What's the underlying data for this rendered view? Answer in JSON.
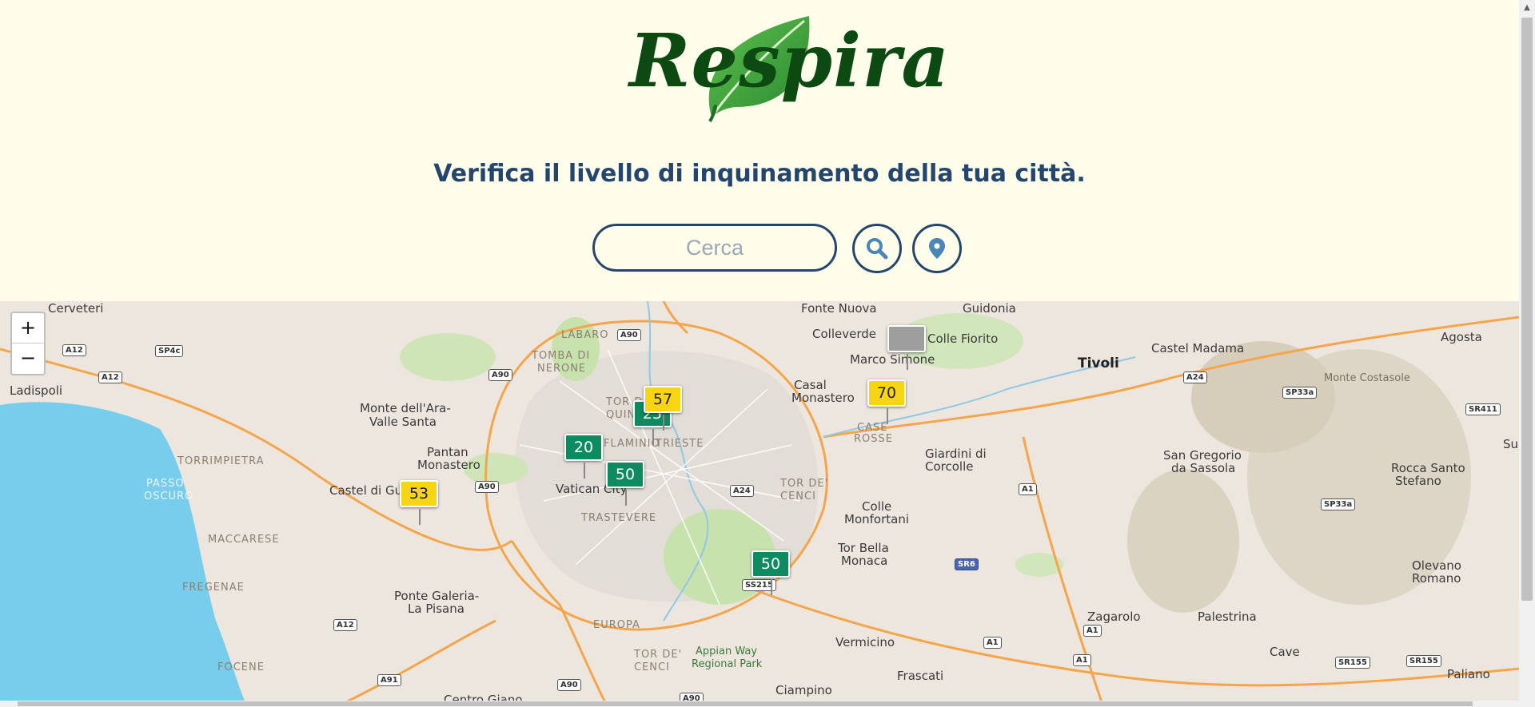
{
  "app": {
    "logo_text": "Respira"
  },
  "header": {
    "tagline": "Verifica il livello di inquinamento della tua città."
  },
  "search": {
    "placeholder": "Cerca",
    "value": ""
  },
  "buttons": {
    "search_icon": "search-icon",
    "location_icon": "location-pin-icon"
  },
  "map": {
    "zoom_in": "+",
    "zoom_out": "−",
    "labels": [
      {
        "text": "Cerveteri",
        "cls": ""
      },
      {
        "text": "Ladispoli",
        "cls": ""
      },
      {
        "text": "Monte dell'Ara-",
        "cls": ""
      },
      {
        "text": "Valle Santa",
        "cls": ""
      },
      {
        "text": "TORRIMPIETRA",
        "cls": "small"
      },
      {
        "text": "PASSO",
        "cls": "sea"
      },
      {
        "text": "OSCURO",
        "cls": "sea"
      },
      {
        "text": "Pantan",
        "cls": ""
      },
      {
        "text": "Monastero",
        "cls": ""
      },
      {
        "text": "Castel di Guido",
        "cls": ""
      },
      {
        "text": "MACCARESE",
        "cls": "small"
      },
      {
        "text": "FREGENAE",
        "cls": "small"
      },
      {
        "text": "Ponte Galeria-",
        "cls": ""
      },
      {
        "text": "La Pisana",
        "cls": ""
      },
      {
        "text": "FOCENE",
        "cls": "small"
      },
      {
        "text": "Centro Giano",
        "cls": ""
      },
      {
        "text": "LABARO",
        "cls": "small"
      },
      {
        "text": "TOMBA DI",
        "cls": "small"
      },
      {
        "text": "NERONE",
        "cls": "small"
      },
      {
        "text": "TOR DI",
        "cls": "small"
      },
      {
        "text": "QUINTO",
        "cls": "small"
      },
      {
        "text": "FLAMINIO",
        "cls": "small"
      },
      {
        "text": "TRIESTE",
        "cls": "small"
      },
      {
        "text": "Vatican City",
        "cls": ""
      },
      {
        "text": "TRASTEVERE",
        "cls": "small"
      },
      {
        "text": "EUROPA",
        "cls": "small"
      },
      {
        "text": "TOR DE'",
        "cls": "small"
      },
      {
        "text": "CENCI",
        "cls": "small"
      },
      {
        "text": "Appian Way",
        "cls": "park"
      },
      {
        "text": "Regional Park",
        "cls": "park"
      },
      {
        "text": "Ciampino",
        "cls": ""
      },
      {
        "text": "Fonte Nuova",
        "cls": ""
      },
      {
        "text": "Colleverde",
        "cls": ""
      },
      {
        "text": "Guidonia",
        "cls": ""
      },
      {
        "text": "Colle Fiorito",
        "cls": ""
      },
      {
        "text": "Marco Simone",
        "cls": ""
      },
      {
        "text": "Casal",
        "cls": ""
      },
      {
        "text": "Monastero",
        "cls": ""
      },
      {
        "text": "CASE",
        "cls": "small"
      },
      {
        "text": "ROSSE",
        "cls": "small"
      },
      {
        "text": "TOR DE'",
        "cls": "small"
      },
      {
        "text": "CENCI",
        "cls": "small"
      },
      {
        "text": "Colle",
        "cls": ""
      },
      {
        "text": "Monfortani",
        "cls": ""
      },
      {
        "text": "Tor Bella",
        "cls": ""
      },
      {
        "text": "Monaca",
        "cls": ""
      },
      {
        "text": "Vermicino",
        "cls": ""
      },
      {
        "text": "Frascati",
        "cls": ""
      },
      {
        "text": "Giardini di",
        "cls": ""
      },
      {
        "text": "Corcolle",
        "cls": ""
      },
      {
        "text": "Tivoli",
        "cls": "big"
      },
      {
        "text": "Castel Madama",
        "cls": ""
      },
      {
        "text": "Monte Costasole",
        "cls": "mountain"
      },
      {
        "text": "Agosta",
        "cls": ""
      },
      {
        "text": "San Gregorio",
        "cls": ""
      },
      {
        "text": "da Sassola",
        "cls": ""
      },
      {
        "text": "Rocca Santo",
        "cls": ""
      },
      {
        "text": "Stefano",
        "cls": ""
      },
      {
        "text": "Zagarolo",
        "cls": ""
      },
      {
        "text": "Palestrina",
        "cls": ""
      },
      {
        "text": "Olevano",
        "cls": ""
      },
      {
        "text": "Romano",
        "cls": ""
      },
      {
        "text": "Cave",
        "cls": ""
      },
      {
        "text": "Paliano",
        "cls": ""
      },
      {
        "text": "Su",
        "cls": ""
      }
    ],
    "shields": [
      {
        "text": "A12",
        "cls": ""
      },
      {
        "text": "SP4c",
        "cls": ""
      },
      {
        "text": "A12",
        "cls": ""
      },
      {
        "text": "A90",
        "cls": ""
      },
      {
        "text": "A90",
        "cls": ""
      },
      {
        "text": "A90",
        "cls": ""
      },
      {
        "text": "A12",
        "cls": ""
      },
      {
        "text": "A91",
        "cls": ""
      },
      {
        "text": "A90",
        "cls": ""
      },
      {
        "text": "A24",
        "cls": ""
      },
      {
        "text": "SS215",
        "cls": ""
      },
      {
        "text": "A24",
        "cls": ""
      },
      {
        "text": "SP33a",
        "cls": ""
      },
      {
        "text": "SR411",
        "cls": ""
      },
      {
        "text": "A1",
        "cls": ""
      },
      {
        "text": "SP33a",
        "cls": ""
      },
      {
        "text": "SR6",
        "cls": "blue"
      },
      {
        "text": "A1",
        "cls": ""
      },
      {
        "text": "A1",
        "cls": ""
      },
      {
        "text": "A1",
        "cls": ""
      },
      {
        "text": "SR155",
        "cls": ""
      },
      {
        "text": "SR155",
        "cls": ""
      },
      {
        "text": "A90",
        "cls": ""
      }
    ],
    "markers": [
      {
        "value": "25",
        "color": "green"
      },
      {
        "value": "57",
        "color": "yellow"
      },
      {
        "value": "20",
        "color": "green"
      },
      {
        "value": "50",
        "color": "green"
      },
      {
        "value": "53",
        "color": "yellow"
      },
      {
        "value": "50",
        "color": "green"
      },
      {
        "value": "70",
        "color": "yellow"
      },
      {
        "value": "–",
        "color": "gray"
      }
    ]
  }
}
